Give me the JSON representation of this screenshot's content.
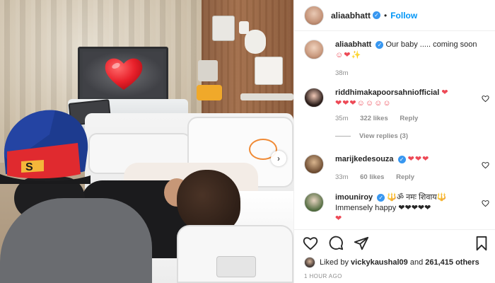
{
  "header": {
    "username": "aliaabhatt",
    "separator": "•",
    "follow_label": "Follow"
  },
  "caption": {
    "username": "aliaabhatt",
    "text": "Our baby ..... coming soon",
    "emojis": "☺❤✨",
    "time": "38m"
  },
  "comments": [
    {
      "username": "riddhimakapoorsahniofficial",
      "hearts_inline": "❤",
      "text": "❤❤❤☺☺☺☺",
      "time": "35m",
      "likes": "322 likes",
      "reply_label": "Reply",
      "view_replies": "View replies (3)"
    },
    {
      "username": "marijkedesouza",
      "text": "❤❤❤",
      "time": "33m",
      "likes": "60 likes",
      "reply_label": "Reply"
    },
    {
      "username": "imouniroy",
      "text": "🔱ॐ नमः शिवाय🔱",
      "text2": "Immensely happy ❤❤❤❤❤",
      "text3": "❤"
    }
  ],
  "liked_by": {
    "prefix": "Liked by",
    "user": "vickykaushal09",
    "middle": "and",
    "count": "261,415 others"
  },
  "timestamp": "1 HOUR AGO",
  "icons": {
    "verified": "verified-badge-icon",
    "like": "heart-outline-icon",
    "comment": "comment-icon",
    "share": "paper-plane-icon",
    "save": "bookmark-icon",
    "next": "chevron-right-icon"
  },
  "colors": {
    "link_blue": "#0095f6",
    "verified_blue": "#3897f0",
    "heart_red": "#ed4956",
    "muted": "#8e8e8e"
  }
}
